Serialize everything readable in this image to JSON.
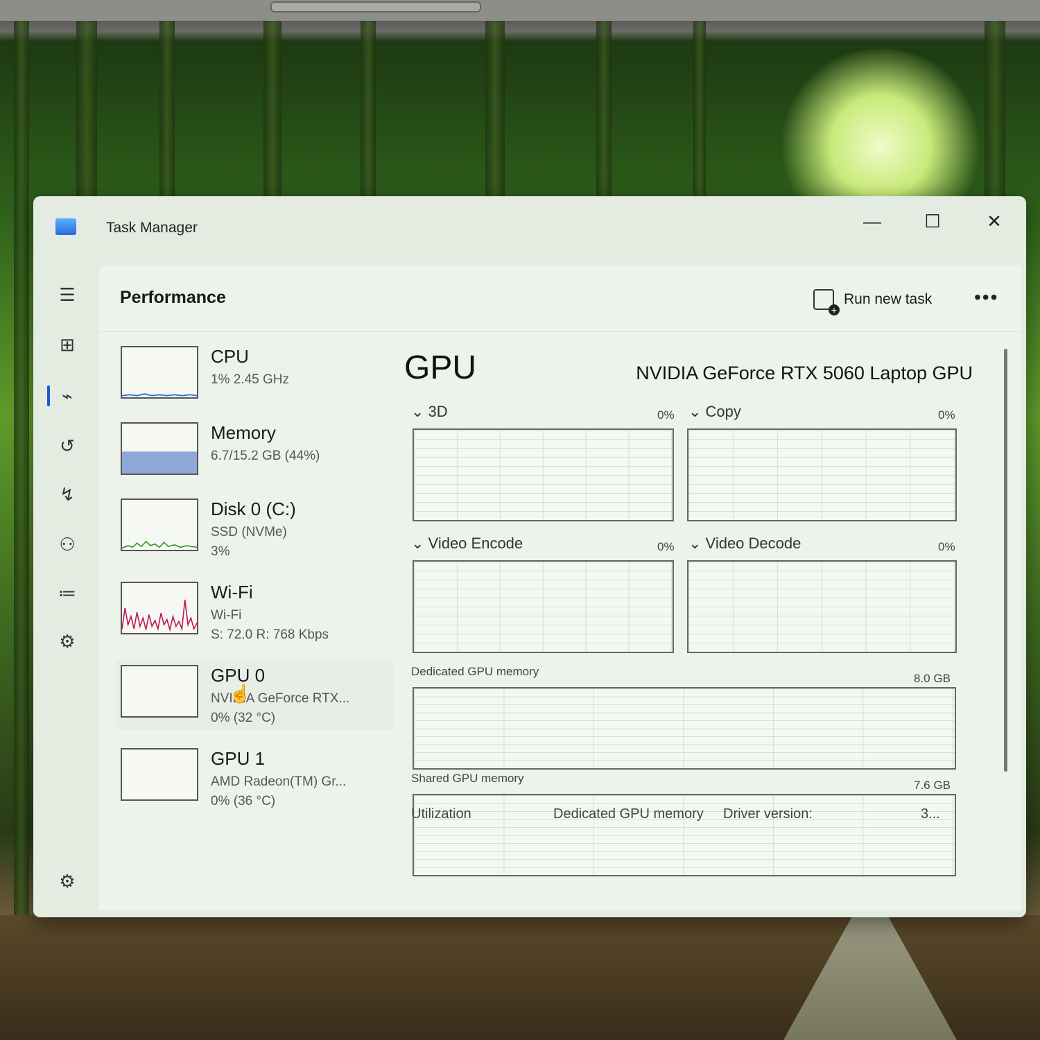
{
  "window": {
    "title": "Task Manager",
    "minimize": "—",
    "maximize": "☐",
    "close": "✕"
  },
  "header": {
    "page_title": "Performance",
    "run_new_task": "Run new task",
    "more": "•••"
  },
  "nav": {
    "icons": [
      "hamburger-icon",
      "processes-icon",
      "performance-icon",
      "app-history-icon",
      "startup-apps-icon",
      "users-icon",
      "details-icon",
      "services-icon",
      "settings-icon"
    ]
  },
  "sidebar": {
    "items": [
      {
        "name": "CPU",
        "line1": "1%  2.45 GHz",
        "line2": ""
      },
      {
        "name": "Memory",
        "line1": "6.7/15.2 GB (44%)",
        "line2": ""
      },
      {
        "name": "Disk 0 (C:)",
        "line1": "SSD (NVMe)",
        "line2": "3%"
      },
      {
        "name": "Wi-Fi",
        "line1": "Wi-Fi",
        "line2": "S: 72.0  R: 768 Kbps"
      },
      {
        "name": "GPU 0",
        "line1": "NVIDIA GeForce RTX...",
        "line2": "0%  (32 °C)"
      },
      {
        "name": "GPU 1",
        "line1": "AMD Radeon(TM) Gr...",
        "line2": "0%  (36 °C)"
      }
    ]
  },
  "detail": {
    "title": "GPU",
    "model": "NVIDIA GeForce RTX 5060 Laptop GPU",
    "engines": [
      {
        "label": "3D",
        "pct": "0%"
      },
      {
        "label": "Copy",
        "pct": "0%"
      },
      {
        "label": "Video Encode",
        "pct": "0%"
      },
      {
        "label": "Video Decode",
        "pct": "0%"
      }
    ],
    "dedicated_label": "Dedicated GPU memory",
    "dedicated_value": "8.0 GB",
    "shared_label": "Shared GPU memory",
    "shared_value": "7.6 GB",
    "bottom": {
      "utilization": "Utilization",
      "dedicated": "Dedicated GPU memory",
      "driver_label": "Driver version:",
      "driver_value": "3..."
    }
  },
  "colors": {
    "cpu": "#2a6ad8",
    "memory": "#7a4fc4",
    "disk": "#3f9a2a",
    "wifi": "#c2185b",
    "accent": "#1a5ad6"
  },
  "usage": {
    "memory_fraction": 0.44
  }
}
